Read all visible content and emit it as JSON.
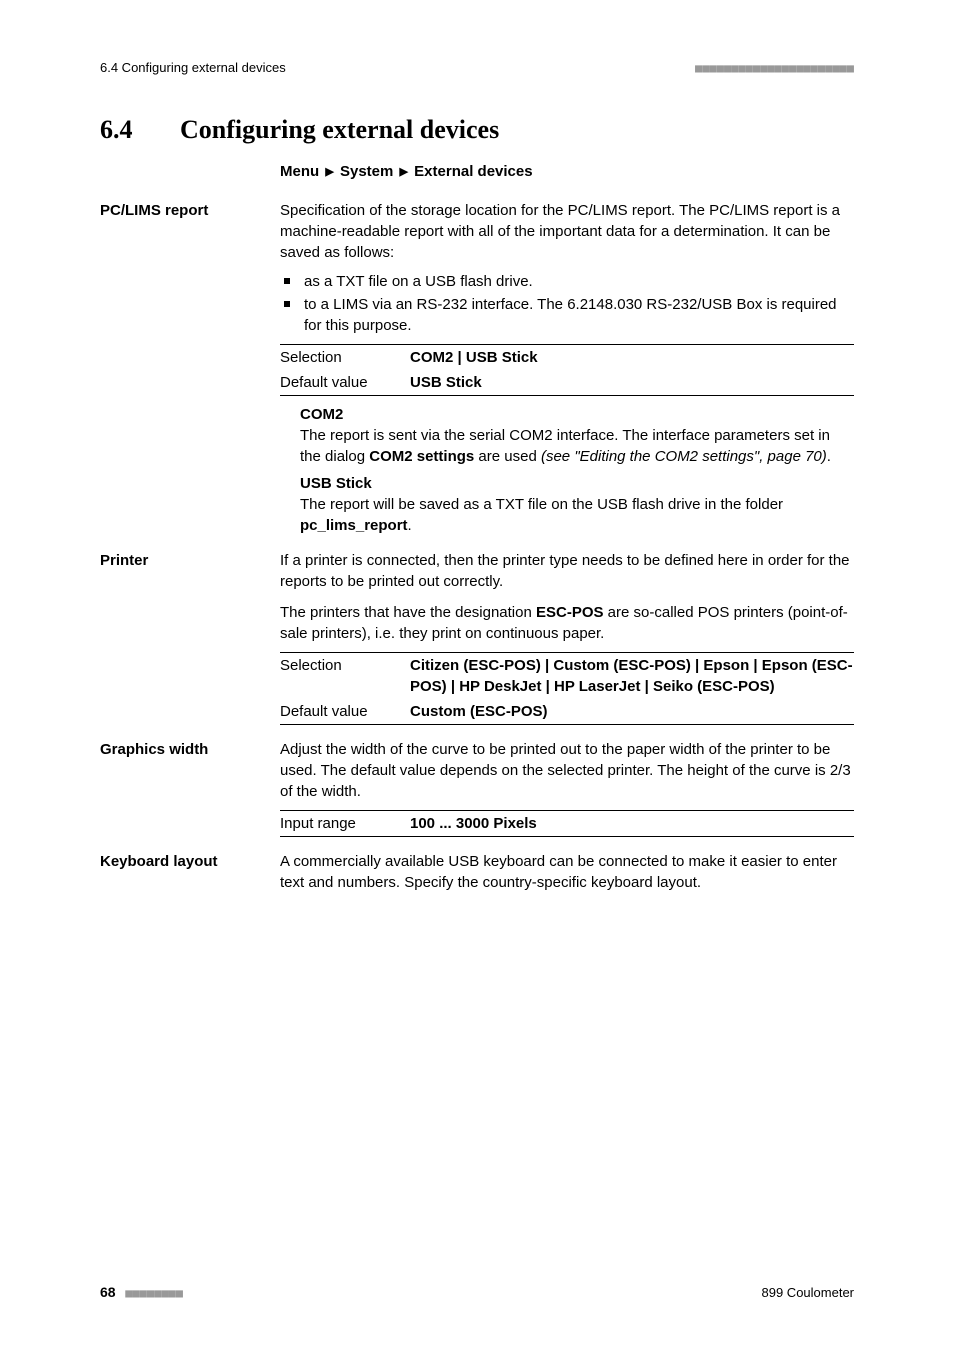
{
  "header": {
    "running_title": "6.4 Configuring external devices"
  },
  "section": {
    "number": "6.4",
    "title": "Configuring external devices",
    "breadcrumb": {
      "a": "Menu",
      "b": "System",
      "c": "External devices"
    }
  },
  "pc_lims": {
    "label": "PC/LIMS report",
    "intro": "Specification of the storage location for the PC/LIMS report. The PC/LIMS report is a machine-readable report with all of the important data for a determination. It can be saved as follows:",
    "bullets": {
      "b1": "as a TXT file on a USB flash drive.",
      "b2": "to a LIMS via an RS-232 interface. The 6.2148.030 RS-232/USB Box is required for this purpose."
    },
    "spec": {
      "sel_key": "Selection",
      "sel_val": "COM2 | USB Stick",
      "def_key": "Default value",
      "def_val": "USB Stick"
    },
    "com2": {
      "label": "COM2",
      "text_a": "The report is sent via the serial COM2 interface. The interface parameters set in the dialog ",
      "text_bold": "COM2 settings",
      "text_b": " are used ",
      "text_italic": "(see \"Editing the COM2 settings\", page 70)",
      "text_c": "."
    },
    "usb": {
      "label": "USB Stick",
      "text_a": "The report will be saved as a TXT file on the USB flash drive in the folder ",
      "text_bold": "pc_lims_report",
      "text_b": "."
    }
  },
  "printer": {
    "label": "Printer",
    "p1": "If a printer is connected, then the printer type needs to be defined here in order for the reports to be printed out correctly.",
    "p2a": "The printers that have the designation ",
    "p2bold": "ESC-POS",
    "p2b": " are so-called POS printers (point-of-sale printers), i.e. they print on continuous paper.",
    "spec": {
      "sel_key": "Selection",
      "sel_val": "Citizen (ESC-POS) | Custom (ESC-POS) | Epson | Epson (ESC-POS) | HP DeskJet | HP LaserJet | Seiko (ESC-POS)",
      "def_key": "Default value",
      "def_val": "Custom (ESC-POS)"
    }
  },
  "graphics": {
    "label": "Graphics width",
    "p1": "Adjust the width of the curve to be printed out to the paper width of the printer to be used. The default value depends on the selected printer. The height of the curve is 2/3 of the width.",
    "spec": {
      "range_key": "Input range",
      "range_val": "100 ... 3000 Pixels"
    }
  },
  "keyboard": {
    "label": "Keyboard layout",
    "p1": "A commercially available USB keyboard can be connected to make it easier to enter text and numbers. Specify the country-specific keyboard layout."
  },
  "footer": {
    "page": "68",
    "product": "899 Coulometer"
  }
}
